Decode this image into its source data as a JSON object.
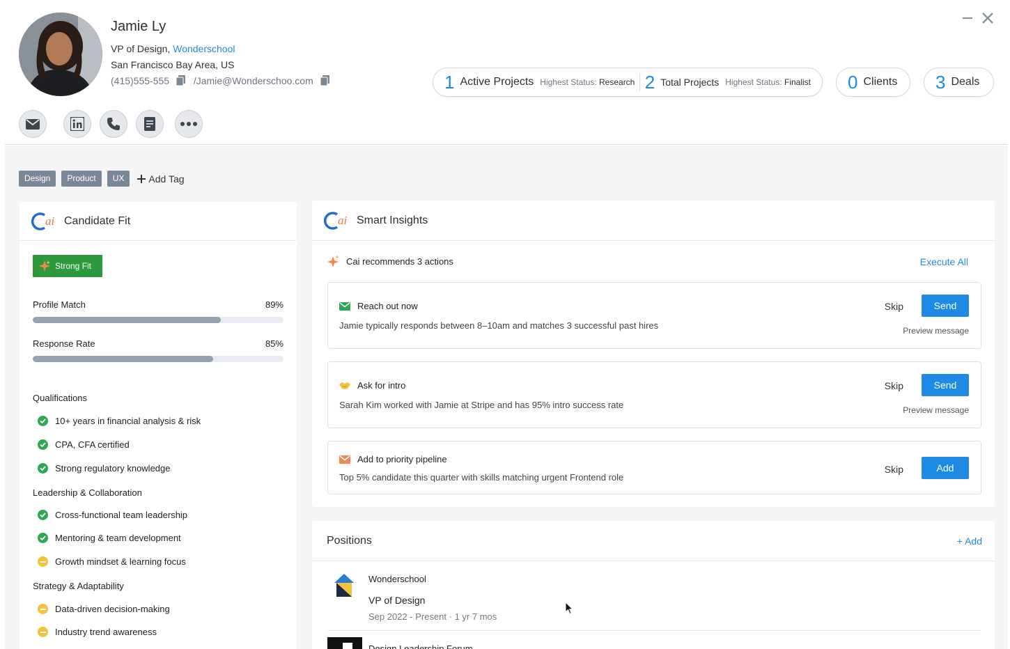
{
  "profile": {
    "name": "Jamie Ly",
    "title_prefix": "VP of Design,",
    "company": "Wonderschool",
    "location": "San Francisco Bay Area, US",
    "phone": "(415)555-555",
    "email": "/Jamie@Wonderschoo.com"
  },
  "contact_actions": [
    "mail-icon",
    "linkedin-icon",
    "phone-icon",
    "notes-icon",
    "more-icon"
  ],
  "stats": {
    "active_projects": {
      "count": "1",
      "label": "Active Projects",
      "sub_label": "Highest Status:",
      "sub_value": "Research"
    },
    "total_projects": {
      "count": "2",
      "label": "Total Projects",
      "sub_label": "Highest Status:",
      "sub_value": "Finalist"
    },
    "clients": {
      "count": "0",
      "label": "Clients"
    },
    "deals": {
      "count": "3",
      "label": "Deals"
    }
  },
  "tags": [
    "Design",
    "Product",
    "UX"
  ],
  "add_tag_label": "Add Tag",
  "candidate_fit": {
    "title": "Candidate Fit",
    "badge": "Strong Fit",
    "metrics": [
      {
        "label": "Profile Match",
        "value": "89%",
        "level": 0.75
      },
      {
        "label": "Response Rate",
        "value": "85%",
        "level": 0.72
      }
    ],
    "sections": [
      {
        "title": "Qualifications",
        "items": [
          {
            "text": "10+ years in financial analysis & risk",
            "status": "ok"
          },
          {
            "text": "CPA, CFA certified",
            "status": "ok"
          },
          {
            "text": "Strong regulatory knowledge",
            "status": "ok"
          }
        ]
      },
      {
        "title": "Leadership & Collaboration",
        "items": [
          {
            "text": "Cross-functional team leadership",
            "status": "ok"
          },
          {
            "text": "Mentoring & team development",
            "status": "ok"
          },
          {
            "text": "Growth mindset & learning focus",
            "status": "partial"
          }
        ]
      },
      {
        "title": "Strategy & Adaptability",
        "items": [
          {
            "text": "Data-driven decision-making",
            "status": "partial"
          },
          {
            "text": "Industry trend awareness",
            "status": "partial"
          }
        ]
      }
    ]
  },
  "insights": {
    "title": "Smart Insights",
    "recommendation": "Cai recommends 3 actions",
    "execute_all": "Execute All",
    "actions": [
      {
        "title": "Reach out now",
        "desc": "Jamie typically responds between 8–10am and matches 3 successful past hires",
        "skip": "Skip",
        "primary": "Send",
        "preview": "Preview message"
      },
      {
        "title": "Ask for intro",
        "desc": "Sarah Kim worked with Jamie at Stripe and has 95% intro success rate",
        "skip": "Skip",
        "primary": "Send",
        "preview": "Preview message"
      },
      {
        "title": "Add to priority pipeline",
        "desc": "Top 5% candidate this quarter with skills matching urgent Frontend role",
        "skip": "Skip",
        "primary": "Add"
      }
    ]
  },
  "positions": {
    "title": "Positions",
    "add_label": "+ Add",
    "items": [
      {
        "company": "Wonderschool",
        "role": "VP of Design",
        "dates": "Sep 2022 - Present · 1 yr 7 mos"
      },
      {
        "company": "Design Leadership Forum"
      }
    ]
  },
  "colors": {
    "accent": "#1f8ae6",
    "fit_green": "#2c9a3c",
    "ok": "#2fa854",
    "partial": "#f5c23e",
    "tag": "#7a8797"
  }
}
